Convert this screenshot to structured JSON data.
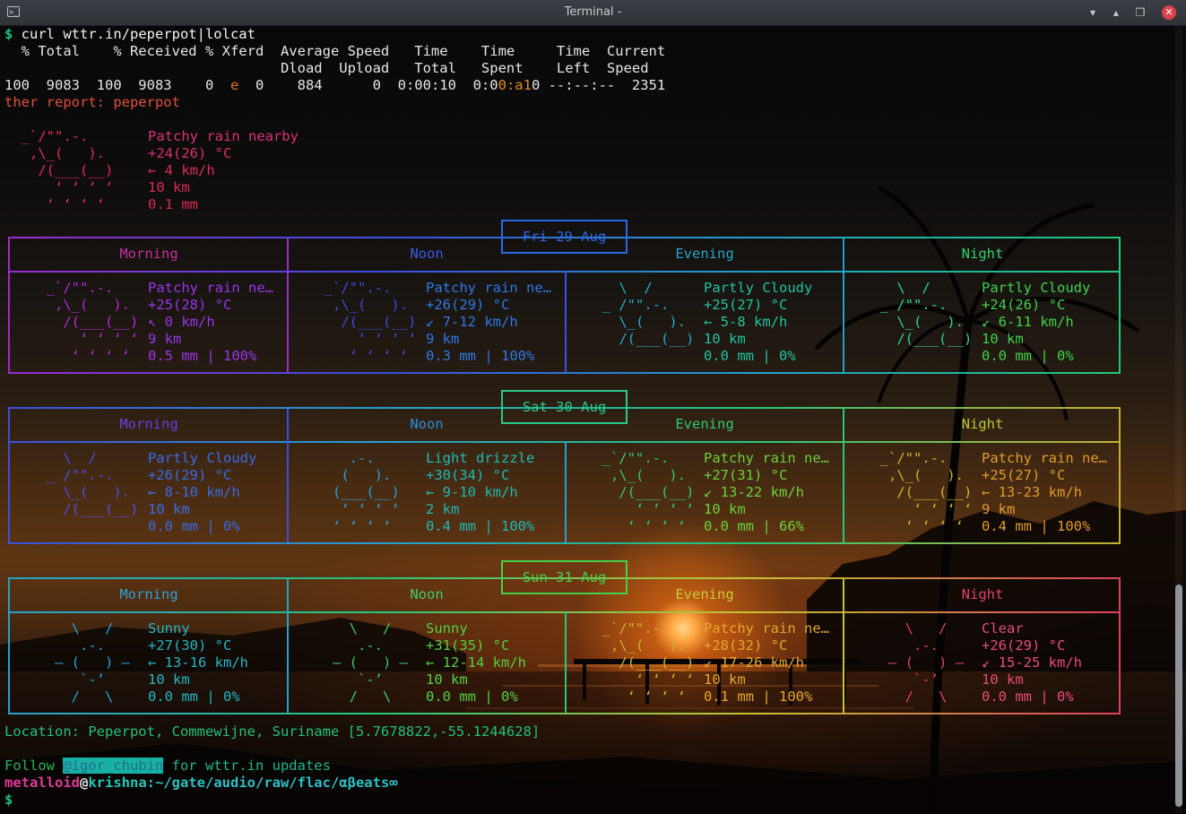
{
  "window": {
    "title": "Terminal -",
    "icon": "terminal-icon",
    "buttons": {
      "minimize": "▾",
      "maximize": "▴",
      "restore": "❐",
      "close": "✕"
    }
  },
  "terminal": {
    "command_line": {
      "prompt": "$",
      "command": " curl wttr.in/peperpot|lolcat"
    },
    "curl_header_1": "  % Total    % Received % Xferd  Average Speed   Time    Time     Time  Current",
    "curl_header_2": "                                 Dload  Upload   Total   Spent    Left  Speed",
    "curl_progress": {
      "a": "100  9083  100  9083    0  ",
      "b": "e",
      "c": "  0    884      0  0:00:10  0:0",
      "d": "0:a1",
      "e": "0 --:--:--  2351"
    },
    "report_title": "ther report: peperpot",
    "current": {
      "ascii": [
        "  _`/\"\".-.    ",
        "   ,\\_(   ).  ",
        "    /(___(__) ",
        "      ʻ ʻ ʻ ʻ ",
        "     ʻ ʻ ʻ ʻ  "
      ],
      "lines": [
        "Patchy rain nearby",
        "+24(26) °C",
        "← 4 km/h",
        "10 km",
        "0.1 mm"
      ]
    },
    "days": [
      {
        "date": "Fri 29 Aug",
        "periods": [
          "Morning",
          "Noon",
          "Evening",
          "Night"
        ],
        "cells": [
          {
            "ascii": [
              "  _`/\"\".-.    ",
              "   ,\\_(   ).  ",
              "    /(___(__) ",
              "      ʻ ʻ ʻ ʻ ",
              "     ʻ ʻ ʻ ʻ  "
            ],
            "lines": [
              "Patchy rain ne…",
              "+25(28) °C",
              "↖ 0 km/h",
              "9 km",
              "0.5 mm | 100%"
            ]
          },
          {
            "ascii": [
              "  _`/\"\".-.    ",
              "   ,\\_(   ).  ",
              "    /(___(__) ",
              "      ʻ ʻ ʻ ʻ ",
              "     ʻ ʻ ʻ ʻ  "
            ],
            "lines": [
              "Patchy rain ne…",
              "+26(29) °C",
              "↙ 7-12 km/h",
              "9 km",
              "0.3 mm | 100%"
            ]
          },
          {
            "ascii": [
              "    \\  /      ",
              "  _ /\"\".-.    ",
              "    \\_(   ).  ",
              "    /(___(__) ",
              "              "
            ],
            "lines": [
              "Partly Cloudy",
              "+25(27) °C",
              "← 5-8 km/h",
              "10 km",
              "0.0 mm | 0%"
            ]
          },
          {
            "ascii": [
              "    \\  /      ",
              "  _ /\"\".-.    ",
              "    \\_(   ).  ",
              "    /(___(__) ",
              "              "
            ],
            "lines": [
              "Partly Cloudy",
              "+24(26) °C",
              "↙ 6-11 km/h",
              "10 km",
              "0.0 mm | 0%"
            ]
          }
        ]
      },
      {
        "date": "Sat 30 Aug",
        "periods": [
          "Morning",
          "Noon",
          "Evening",
          "Night"
        ],
        "cells": [
          {
            "ascii": [
              "    \\  /      ",
              "  _ /\"\".-.    ",
              "    \\_(   ).  ",
              "    /(___(__) ",
              "              "
            ],
            "lines": [
              "Partly Cloudy",
              "+26(29) °C",
              "← 8-10 km/h",
              "10 km",
              "0.0 mm | 0%"
            ]
          },
          {
            "ascii": [
              "     .-.      ",
              "    (   ).    ",
              "   (___(__)   ",
              "    ʻ ʻ ʻ ʻ   ",
              "   ʻ ʻ ʻ ʻ    "
            ],
            "lines": [
              "Light drizzle",
              "+30(34) °C",
              "← 9-10 km/h",
              "2 km",
              "0.4 mm | 100%"
            ]
          },
          {
            "ascii": [
              "  _`/\"\".-.    ",
              "   ,\\_(   ).  ",
              "    /(___(__) ",
              "      ʻ ʻ ʻ ʻ ",
              "     ʻ ʻ ʻ ʻ  "
            ],
            "lines": [
              "Patchy rain ne…",
              "+27(31) °C",
              "↙ 13-22 km/h",
              "10 km",
              "0.0 mm | 66%"
            ]
          },
          {
            "ascii": [
              "  _`/\"\".-.    ",
              "   ,\\_(   ).  ",
              "    /(___(__) ",
              "      ʻ ʻ ʻ ʻ ",
              "     ʻ ʻ ʻ ʻ  "
            ],
            "lines": [
              "Patchy rain ne…",
              "+25(27) °C",
              "← 13-23 km/h",
              "9 km",
              "0.4 mm | 100%"
            ]
          }
        ]
      },
      {
        "date": "Sun 31 Aug",
        "periods": [
          "Morning",
          "Noon",
          "Evening",
          "Night"
        ],
        "cells": [
          {
            "ascii": [
              "     \\   /    ",
              "      .-.     ",
              "   ― (   ) ―  ",
              "      `-’     ",
              "     /   \\    "
            ],
            "lines": [
              "Sunny",
              "+27(30) °C",
              "← 13-16 km/h",
              "10 km",
              "0.0 mm | 0%"
            ]
          },
          {
            "ascii": [
              "     \\   /    ",
              "      .-.     ",
              "   ― (   ) ―  ",
              "      `-’     ",
              "     /   \\    "
            ],
            "lines": [
              "Sunny",
              "+31(35) °C",
              "← 12-14 km/h",
              "10 km",
              "0.0 mm | 0%"
            ]
          },
          {
            "ascii": [
              "  _`/\"\".-.    ",
              "   ,\\_(   ).  ",
              "    /(___(__) ",
              "      ʻ ʻ ʻ ʻ ",
              "     ʻ ʻ ʻ ʻ  "
            ],
            "lines": [
              "Patchy rain ne…",
              "+28(32) °C",
              "↙ 17-26 km/h",
              "10 km",
              "0.1 mm | 100%"
            ]
          },
          {
            "ascii": [
              "     \\   /    ",
              "      .-.     ",
              "   ― (   ) ―  ",
              "      `-’     ",
              "     /   \\    "
            ],
            "lines": [
              "Clear",
              "+26(29) °C",
              "↙ 15-25 km/h",
              "10 km",
              "0.0 mm | 0%"
            ]
          }
        ]
      }
    ],
    "location_line": "Location: Peperpot, Commewijne, Suriname [5.7678822,-55.1244628]",
    "follow": {
      "before": "Follow ",
      "handle": "@igor_chubin",
      "after": " for wttr.in updates"
    },
    "prompt_line": {
      "user": "metalloid",
      "at": "@",
      "host": "krishna",
      "path": ":~/gate/audio/raw/flac/αβeats∞"
    },
    "final_prompt": "$"
  },
  "colors": {
    "prompt": "#19c37d",
    "accent_pink": "#e0307f",
    "link_highlight": "#19b1a6"
  }
}
